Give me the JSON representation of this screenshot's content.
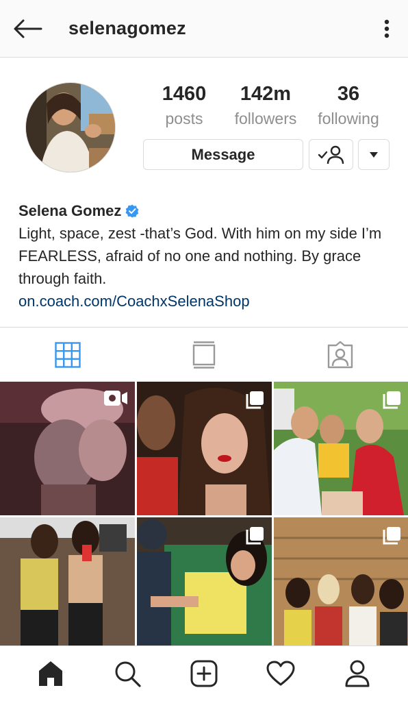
{
  "header": {
    "username": "selenagomez",
    "back_icon": "arrow-left-icon",
    "more_icon": "more-vertical-icon"
  },
  "profile": {
    "stats": [
      {
        "value": "1460",
        "label": "posts"
      },
      {
        "value": "142m",
        "label": "followers"
      },
      {
        "value": "36",
        "label": "following"
      }
    ],
    "actions": {
      "message_label": "Message",
      "following_icon": "person-check-icon",
      "dropdown_icon": "caret-down-icon"
    },
    "bio": {
      "name": "Selena Gomez",
      "verified_icon": "verified-badge-icon",
      "text": "Light, space, zest -that’s God. With him on my side I’m FEARLESS, afraid of no one and nothing. By grace through faith.",
      "link": "on.coach.com/CoachxSelenaShop"
    }
  },
  "tabs": [
    {
      "icon": "grid-icon",
      "active": true
    },
    {
      "icon": "feed-icon",
      "active": false
    },
    {
      "icon": "tagged-icon",
      "active": false
    }
  ],
  "posts": [
    {
      "badge": "video-icon"
    },
    {
      "badge": "multiple-icon"
    },
    {
      "badge": "multiple-icon"
    },
    {
      "badge": ""
    },
    {
      "badge": "multiple-icon"
    },
    {
      "badge": "multiple-icon"
    }
  ],
  "bottom_nav": [
    "home-icon",
    "search-icon",
    "add-post-icon",
    "activity-heart-icon",
    "profile-icon"
  ],
  "colors": {
    "accent_blue": "#3897f0",
    "link_blue": "#003569",
    "border": "#dbdbdb",
    "muted_text": "#8e8e8e"
  }
}
